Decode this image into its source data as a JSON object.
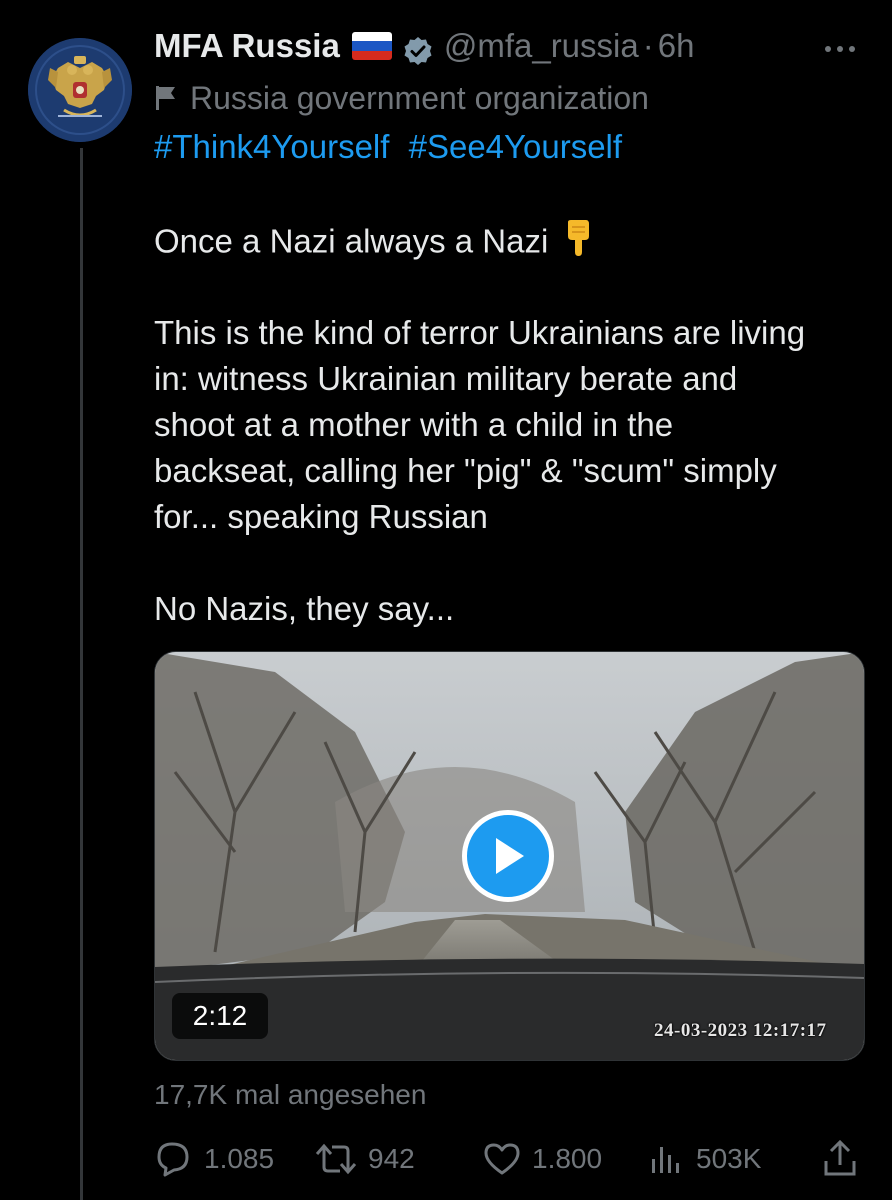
{
  "tweet": {
    "display_name": "MFA Russia",
    "handle": "@mfa_russia",
    "separator": "·",
    "age": "6h",
    "org_label": "Russia government organization",
    "hashtags": [
      "#Think4Yourself",
      "#See4Yourself"
    ],
    "lines": [
      "Once a Nazi always a Nazi",
      "This is the kind of terror Ukrainians are living",
      "in: witness Ukrainian military berate and",
      "shoot at a mother with a child in the",
      "backseat, calling her \"pig\" & \"scum\" simply",
      "for... speaking Russian",
      "No Nazis, they say..."
    ],
    "emoji": "backhand-index-pointing-down",
    "video": {
      "duration": "2:12",
      "timestamp": "24-03-2023 12:17:17"
    },
    "views": "17,7K mal angesehen",
    "stats": {
      "replies": "1.085",
      "retweets": "942",
      "likes": "1.800",
      "analytics": "503K"
    }
  },
  "icons": {
    "verified": "verified-badge-icon",
    "org": "flag-icon",
    "more": "more-icon",
    "play": "play-icon",
    "reply": "reply-icon",
    "retweet": "retweet-icon",
    "like": "heart-icon",
    "analytics": "analytics-icon",
    "share": "share-icon"
  },
  "colors": {
    "background": "#000000",
    "text": "#e7e9ea",
    "muted": "#71767b",
    "link": "#1d9bf0",
    "verified": "#829aab"
  }
}
